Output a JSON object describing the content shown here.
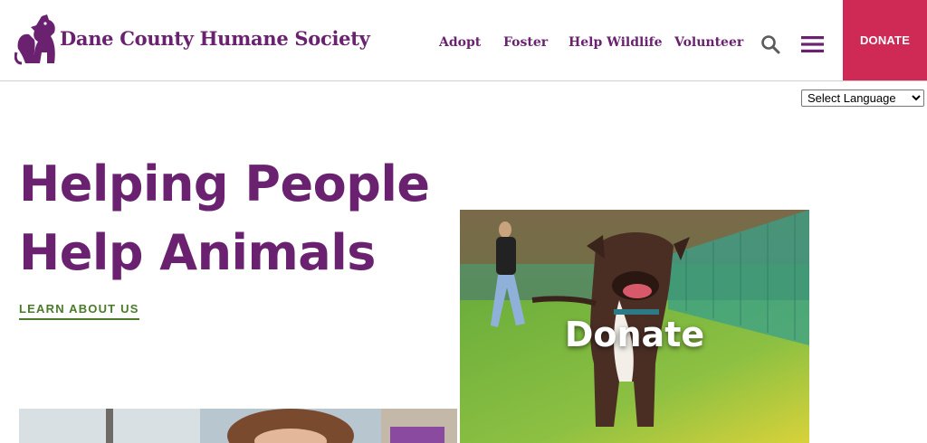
{
  "header": {
    "org_name": "Dane County Humane Society",
    "nav": [
      {
        "label": "Adopt"
      },
      {
        "label": "Foster"
      },
      {
        "label": "Help Wildlife"
      },
      {
        "label": "Volunteer"
      }
    ],
    "donate_label": "DONATE",
    "search_icon": "search-icon",
    "menu_icon": "hamburger-menu-icon"
  },
  "language": {
    "selected": "Select Language"
  },
  "hero": {
    "title_line1": "Helping People",
    "title_line2": "Help Animals",
    "link_label": "LEARN ABOUT US"
  },
  "donate_card": {
    "label": "Donate"
  },
  "colors": {
    "brand_purple": "#6a2270",
    "donate_red": "#cf2a55",
    "link_green": "#4a7a2a"
  }
}
